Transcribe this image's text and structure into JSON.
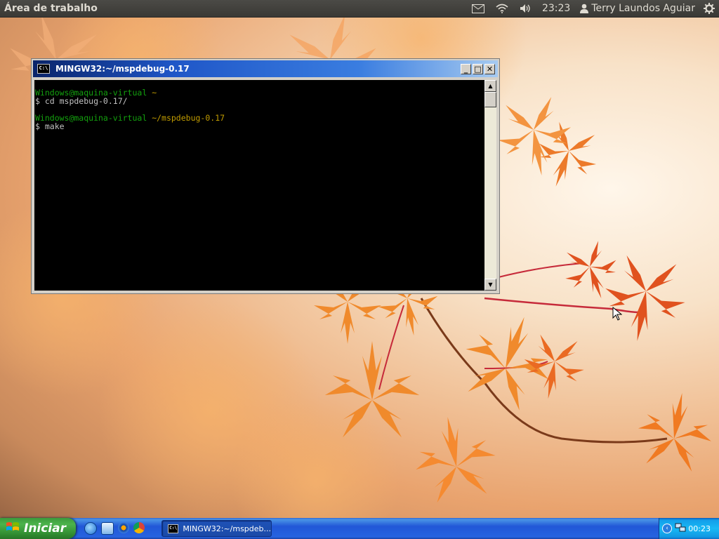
{
  "top_panel": {
    "app_title": "Área de trabalho",
    "clock": "23:23",
    "user_name": "Terry Laundos Aguiar",
    "icons": [
      "mail-icon",
      "wifi-icon",
      "volume-icon",
      "user-icon",
      "gear-icon"
    ]
  },
  "console_window": {
    "title": "MINGW32:~/mspdebug-0.17",
    "icon_label": "C:\\",
    "buttons": {
      "minimize": "_",
      "maximize": "□",
      "close": "✕"
    },
    "lines": [
      {
        "prompt": "Windows@maquina-virtual",
        "path": "~"
      },
      {
        "command": "$ cd mspdebug-0.17/"
      },
      {
        "prompt": "Windows@maquina-virtual",
        "path": "~/mspdebug-0.17"
      },
      {
        "command": "$ make"
      }
    ]
  },
  "taskbar": {
    "start_label": "Iniciar",
    "quick_launch": [
      "ie-icon",
      "recycle-icon",
      "media-player-icon",
      "chrome-icon"
    ],
    "task_item_label": "MINGW32:~/mspdeb...",
    "tray_clock": "00:23"
  },
  "colors": {
    "prompt_green": "#13a10e",
    "path_yellow": "#c19c00",
    "taskbar_blue": "#2157d7",
    "start_green": "#3c9a3c"
  }
}
